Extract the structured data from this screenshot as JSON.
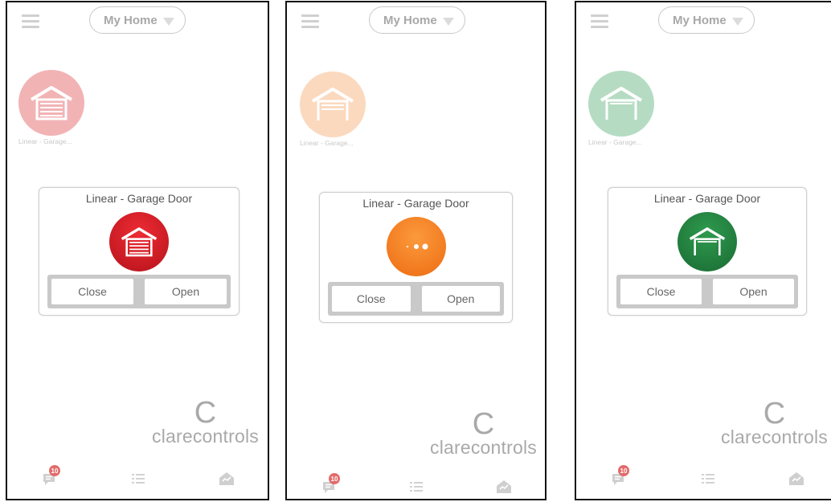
{
  "screens": [
    {
      "state": "closed",
      "header": {
        "location": "My Home"
      },
      "tile": {
        "label": "Linear - Garage..."
      },
      "card": {
        "title": "Linear - Garage Door",
        "close_label": "Close",
        "open_label": "Open"
      },
      "colors": {
        "accent": "#d8222b",
        "tile": "#f2b3b5"
      },
      "brand": {
        "mark": "C",
        "name": "clarecontrols"
      },
      "tabs": {
        "messages_badge": "10"
      }
    },
    {
      "state": "moving",
      "header": {
        "location": "My Home"
      },
      "tile": {
        "label": "Linear - Garage..."
      },
      "card": {
        "title": "Linear - Garage Door",
        "close_label": "Close",
        "open_label": "Open"
      },
      "colors": {
        "accent": "#f27a1a",
        "tile": "#fbd9bf"
      },
      "brand": {
        "mark": "C",
        "name": "clarecontrols"
      },
      "tabs": {
        "messages_badge": "10"
      }
    },
    {
      "state": "open",
      "header": {
        "location": "My Home"
      },
      "tile": {
        "label": "Linear - Garage..."
      },
      "card": {
        "title": "Linear - Garage Door",
        "close_label": "Close",
        "open_label": "Open"
      },
      "colors": {
        "accent": "#1f7a3a",
        "tile": "#b5dcc3"
      },
      "brand": {
        "mark": "C",
        "name": "clarecontrols"
      },
      "tabs": {
        "messages_badge": "10"
      }
    }
  ]
}
